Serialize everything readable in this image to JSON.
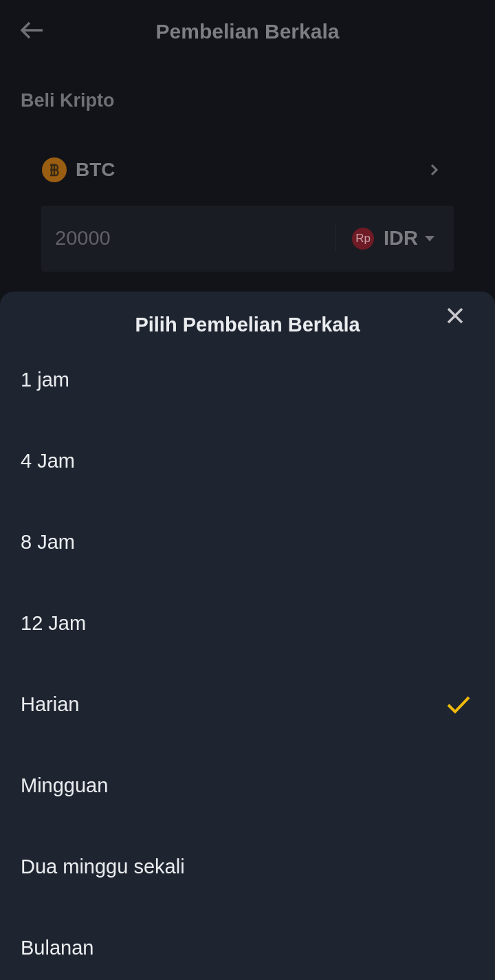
{
  "header": {
    "title": "Pembelian Berkala"
  },
  "section": {
    "title": "Beli Kripto"
  },
  "asset": {
    "symbol": "BTC"
  },
  "amount": {
    "value": "20000",
    "currency_badge": "Rp",
    "currency": "IDR"
  },
  "sheet": {
    "title": "Pilih Pembelian Berkala",
    "options": [
      {
        "label": "1 jam",
        "selected": false
      },
      {
        "label": "4 Jam",
        "selected": false
      },
      {
        "label": "8 Jam",
        "selected": false
      },
      {
        "label": "12 Jam",
        "selected": false
      },
      {
        "label": "Harian",
        "selected": true
      },
      {
        "label": "Mingguan",
        "selected": false
      },
      {
        "label": "Dua minggu sekali",
        "selected": false
      },
      {
        "label": "Bulanan",
        "selected": false
      }
    ]
  }
}
